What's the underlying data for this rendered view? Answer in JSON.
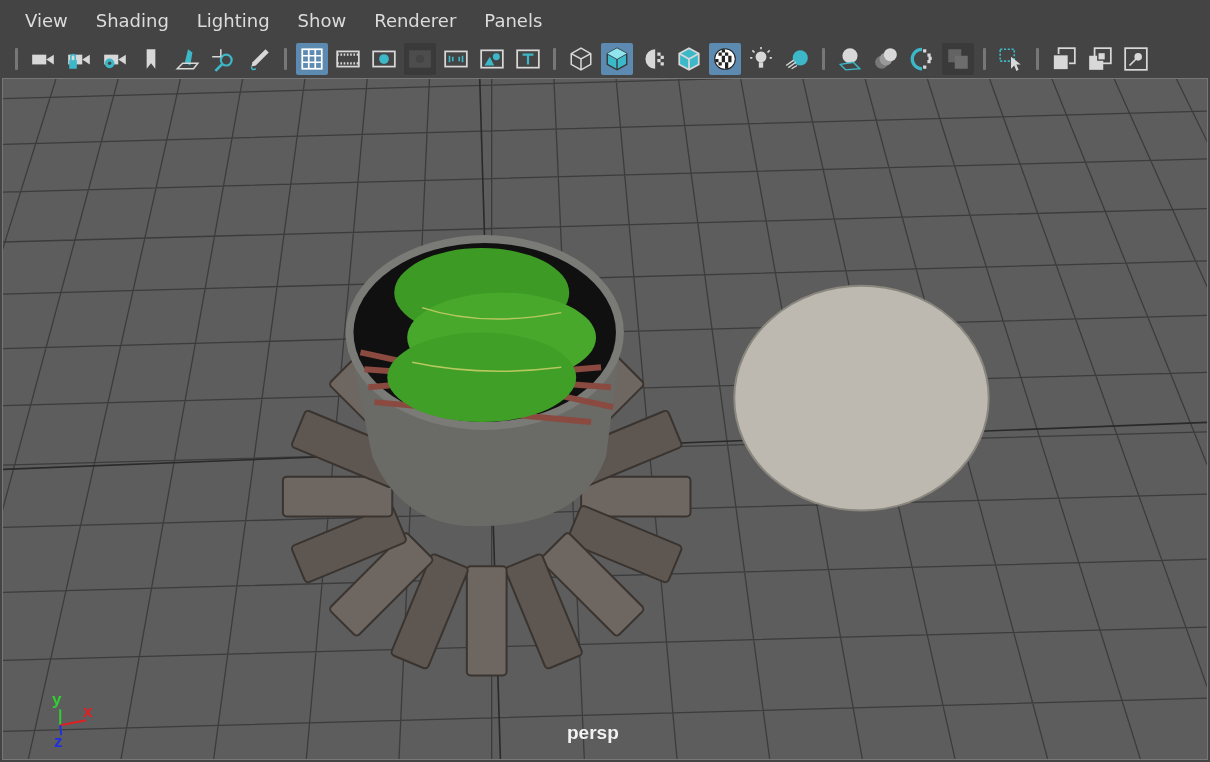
{
  "menu": [
    "View",
    "Shading",
    "Lighting",
    "Show",
    "Renderer",
    "Panels"
  ],
  "toolbar": {
    "groups": [
      [
        {
          "selected": false,
          "disabled": false
        },
        {
          "selected": false,
          "disabled": false
        },
        {
          "selected": false,
          "disabled": false
        },
        {
          "selected": false,
          "disabled": false
        },
        {
          "selected": false,
          "disabled": false
        },
        {
          "selected": false,
          "disabled": false
        },
        {
          "selected": false,
          "disabled": false
        }
      ],
      [
        {
          "selected": true,
          "disabled": false
        },
        {
          "selected": false,
          "disabled": false
        },
        {
          "selected": false,
          "disabled": false
        },
        {
          "selected": false,
          "disabled": true
        },
        {
          "selected": false,
          "disabled": false
        },
        {
          "selected": false,
          "disabled": false
        },
        {
          "selected": false,
          "disabled": false
        }
      ],
      [
        {
          "selected": false,
          "disabled": false
        },
        {
          "selected": true,
          "disabled": false
        },
        {
          "selected": false,
          "disabled": false
        },
        {
          "selected": false,
          "disabled": false
        },
        {
          "selected": true,
          "disabled": false
        },
        {
          "selected": false,
          "disabled": false
        },
        {
          "selected": false,
          "disabled": false
        }
      ],
      [
        {
          "selected": false,
          "disabled": false
        },
        {
          "selected": false,
          "disabled": false
        },
        {
          "selected": false,
          "disabled": false
        },
        {
          "selected": false,
          "disabled": true
        }
      ],
      [
        {
          "selected": false,
          "disabled": false
        }
      ],
      [
        {
          "selected": false,
          "disabled": false
        },
        {
          "selected": false,
          "disabled": false
        },
        {
          "selected": false,
          "disabled": false
        }
      ]
    ]
  },
  "viewport": {
    "camera_label": "persp",
    "axes": [
      {
        "label": "x",
        "color": "#e02020"
      },
      {
        "label": "y",
        "color": "#30d030"
      },
      {
        "label": "z",
        "color": "#2030e0"
      }
    ]
  }
}
